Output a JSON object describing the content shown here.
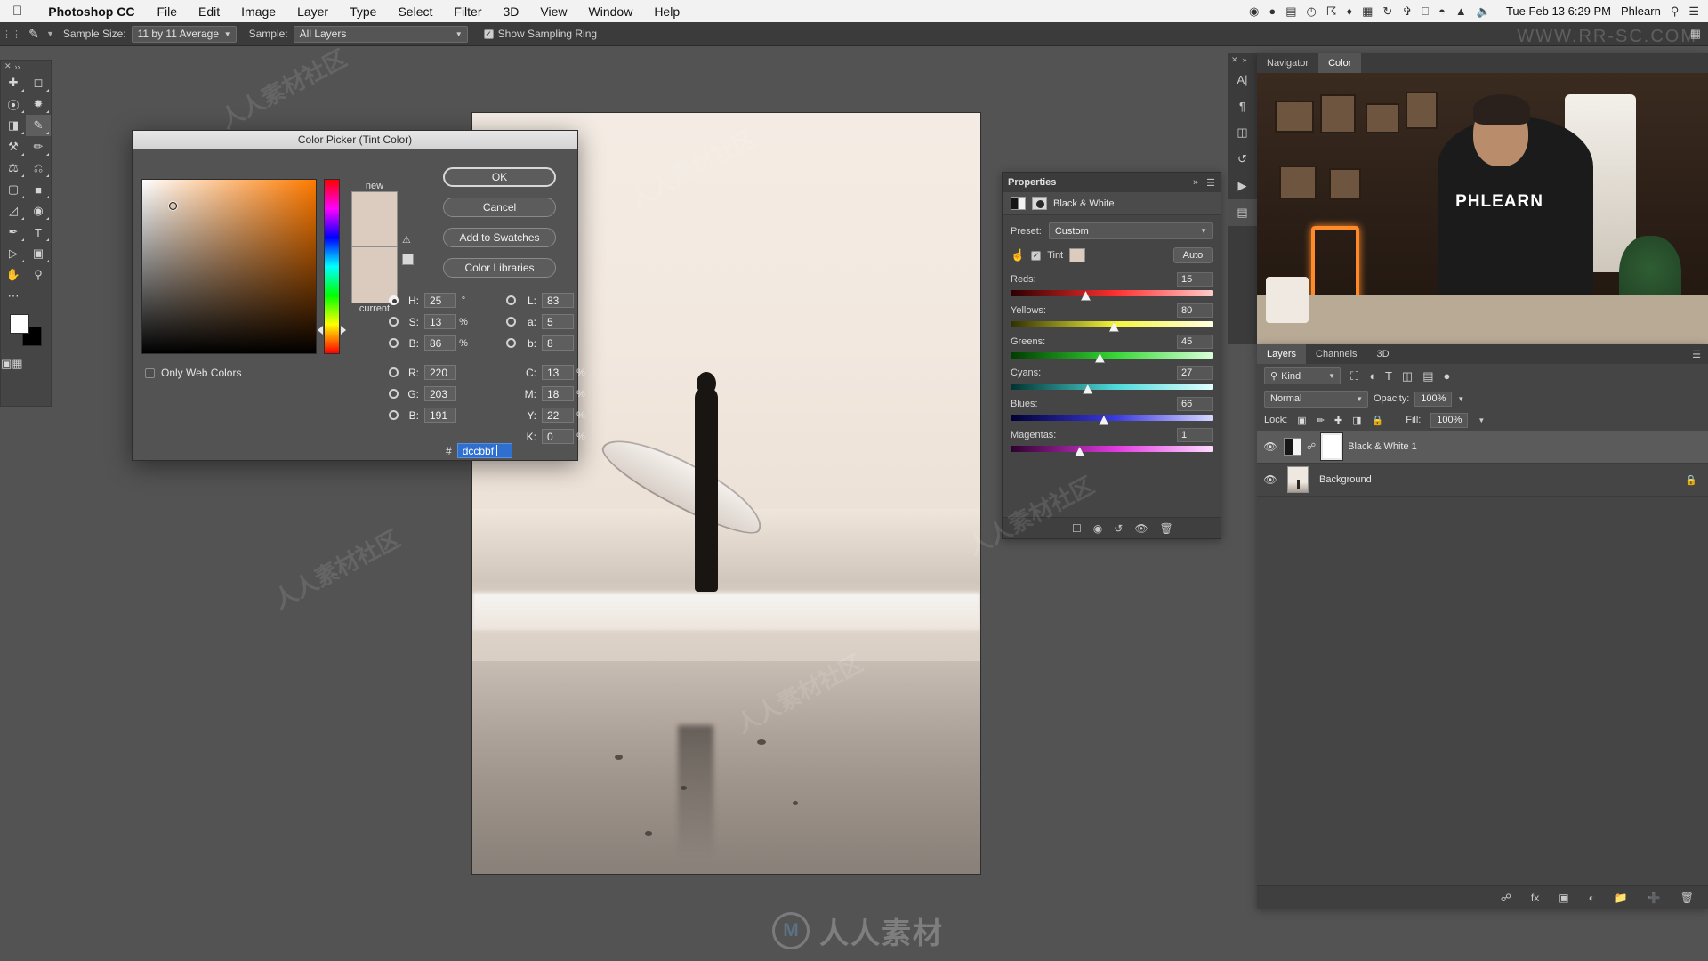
{
  "menubar": {
    "apple_icon": "apple-icon",
    "app_name": "Photoshop CC",
    "items": [
      "File",
      "Edit",
      "Image",
      "Layer",
      "Type",
      "Select",
      "Filter",
      "3D",
      "View",
      "Window",
      "Help"
    ],
    "status_icons": [
      "screen-record-icon",
      "user-icon",
      "display-icon",
      "clock-icon",
      "dropbox-icon",
      "drive-icon",
      "grid-icon",
      "time-machine-icon",
      "bluetooth-icon",
      "airplay-icon",
      "wifi-icon",
      "eject-icon",
      "volume-icon"
    ],
    "datetime": "Tue Feb 13  6:29 PM",
    "user": "Phlearn",
    "search_icon": "search-icon",
    "control_center_icon": "list-icon"
  },
  "options_bar": {
    "tool_icon": "eyedropper-icon",
    "sample_size_label": "Sample Size:",
    "sample_size_value": "11 by 11 Average",
    "sample_label": "Sample:",
    "sample_value": "All Layers",
    "show_sampling_ring_label": "Show Sampling Ring",
    "show_sampling_ring_checked": true,
    "workspace_icon": "workspace-icon"
  },
  "toolbar": {
    "tools": [
      "move-tool",
      "marquee-tool",
      "lasso-tool",
      "quick-select-tool",
      "crop-tool",
      "eyedropper-tool",
      "healing-brush-tool",
      "brush-tool",
      "clone-stamp-tool",
      "history-brush-tool",
      "eraser-tool",
      "gradient-tool",
      "blur-tool",
      "dodge-tool",
      "pen-tool",
      "type-tool",
      "path-select-tool",
      "shape-tool",
      "hand-tool",
      "zoom-tool",
      "more-tools",
      "edit-toolbar"
    ],
    "active_tool": "eyedropper-tool",
    "foreground_color": "#ffffff",
    "background_color": "#000000",
    "quick_mask_icon": "quick-mask-icon",
    "screen_mode_icon": "screen-mode-icon"
  },
  "color_picker": {
    "title": "Color Picker (Tint Color)",
    "new_label": "new",
    "current_label": "current",
    "new_color": "#dccbbf",
    "current_color": "#dbcabe",
    "gamut_warning_icon": "gamut-warning-icon",
    "web_safe_icon": "web-safe-icon",
    "buttons": [
      "OK",
      "Cancel",
      "Add to Swatches",
      "Color Libraries"
    ],
    "only_web_colors_label": "Only Web Colors",
    "only_web_colors_checked": false,
    "hsb": [
      {
        "id": "H",
        "label": "H:",
        "value": "25",
        "unit": "°",
        "selected": true
      },
      {
        "id": "S",
        "label": "S:",
        "value": "13",
        "unit": "%",
        "selected": false
      },
      {
        "id": "B",
        "label": "B:",
        "value": "86",
        "unit": "%",
        "selected": false
      }
    ],
    "rgb": [
      {
        "id": "R",
        "label": "R:",
        "value": "220",
        "unit": "",
        "selected": false
      },
      {
        "id": "G",
        "label": "G:",
        "value": "203",
        "unit": "",
        "selected": false
      },
      {
        "id": "B",
        "label": "B:",
        "value": "191",
        "unit": "",
        "selected": false
      }
    ],
    "lab": [
      {
        "id": "L",
        "label": "L:",
        "value": "83",
        "unit": "",
        "selected": false
      },
      {
        "id": "a",
        "label": "a:",
        "value": "5",
        "unit": "",
        "selected": false
      },
      {
        "id": "b",
        "label": "b:",
        "value": "8",
        "unit": "",
        "selected": false
      }
    ],
    "cmyk": [
      {
        "id": "C",
        "label": "C:",
        "value": "13",
        "unit": "%"
      },
      {
        "id": "M",
        "label": "M:",
        "value": "18",
        "unit": "%"
      },
      {
        "id": "Y",
        "label": "Y:",
        "value": "22",
        "unit": "%"
      },
      {
        "id": "K",
        "label": "K:",
        "value": "0",
        "unit": "%"
      }
    ],
    "hex_symbol": "#",
    "hex_value": "dccbbf"
  },
  "properties_panel": {
    "title": "Properties",
    "collapse_icon": "chevron-right-icon",
    "menu_icon": "panel-menu-icon",
    "adjustment_icon": "black-white-icon",
    "mask_icon": "mask-icon",
    "adjustment_name": "Black & White",
    "preset_label": "Preset:",
    "preset_value": "Custom",
    "targeted_adjust_icon": "targeted-adjustment-icon",
    "tint_label": "Tint",
    "tint_checked": true,
    "tint_color": "#dccbbf",
    "auto_label": "Auto",
    "sliders": [
      {
        "label": "Reds:",
        "value": "15",
        "pct": 15,
        "from": "#2a0000",
        "to": "#ffc9c9",
        "mid": "#ff2f2f"
      },
      {
        "label": "Yellows:",
        "value": "80",
        "pct": 42,
        "from": "#303000",
        "to": "#ffffe0",
        "mid": "#f5f53c"
      },
      {
        "label": "Greens:",
        "value": "45",
        "pct": 33,
        "from": "#003c00",
        "to": "#d8ffd8",
        "mid": "#37d637"
      },
      {
        "label": "Cyans:",
        "value": "27",
        "pct": 28,
        "from": "#00322f",
        "to": "#e0ffff",
        "mid": "#4fd9d9"
      },
      {
        "label": "Blues:",
        "value": "66",
        "pct": 36,
        "from": "#000033",
        "to": "#d6d6ff",
        "mid": "#3a3ae0"
      },
      {
        "label": "Magentas:",
        "value": "1",
        "pct": 22,
        "from": "#2d002d",
        "to": "#ffd9ff",
        "mid": "#e03ae0"
      }
    ],
    "footer_icons": [
      "clip-to-layer-icon",
      "view-previous-icon",
      "reset-icon",
      "toggle-visibility-icon",
      "delete-icon"
    ]
  },
  "nav_dock": {
    "close_icon": "close-icon",
    "expand_icon": "chevron-double-right-icon",
    "tabs": [
      {
        "label": "Navigator",
        "selected": false
      },
      {
        "label": "Color",
        "selected": true
      }
    ],
    "rail_icons": [
      "type-icon",
      "paragraph-icon",
      "layers-comp-icon",
      "history-icon",
      "actions-icon",
      "properties-icon"
    ],
    "video_shirt_text": "PHLEARN"
  },
  "layers_panel": {
    "tabs": [
      {
        "label": "Layers",
        "selected": true
      },
      {
        "label": "Channels",
        "selected": false
      },
      {
        "label": "3D",
        "selected": false
      }
    ],
    "menu_icon": "panel-menu-icon",
    "filter_icon": "search-icon",
    "filter_kind_value": "Kind",
    "filter_icons": [
      "pixel-layer-filter-icon",
      "adjustment-filter-icon",
      "type-filter-icon",
      "shape-filter-icon",
      "smart-object-filter-icon",
      "filter-toggle-icon"
    ],
    "blend_mode": "Normal",
    "opacity_label": "Opacity:",
    "opacity_value": "100%",
    "lock_label": "Lock:",
    "lock_icons": [
      "lock-transparent-icon",
      "lock-image-icon",
      "lock-position-icon",
      "lock-artboard-icon",
      "lock-all-icon"
    ],
    "fill_label": "Fill:",
    "fill_value": "100%",
    "layers": [
      {
        "name": "Black & White 1",
        "visible": true,
        "selected": true,
        "locked": false,
        "type": "adjustment"
      },
      {
        "name": "Background",
        "visible": true,
        "selected": false,
        "locked": true,
        "type": "pixel"
      }
    ],
    "footer_icons": [
      "link-layers-icon",
      "layer-style-icon",
      "add-mask-icon",
      "new-adjustment-icon",
      "new-group-icon",
      "new-layer-icon",
      "delete-layer-icon"
    ]
  },
  "watermark": {
    "text": "人人素材",
    "logo_letter": "M",
    "url": "WWW.RR-SC.COM",
    "tiles": [
      "人人素材社区",
      "人人素材社区",
      "人人素材社区"
    ]
  }
}
